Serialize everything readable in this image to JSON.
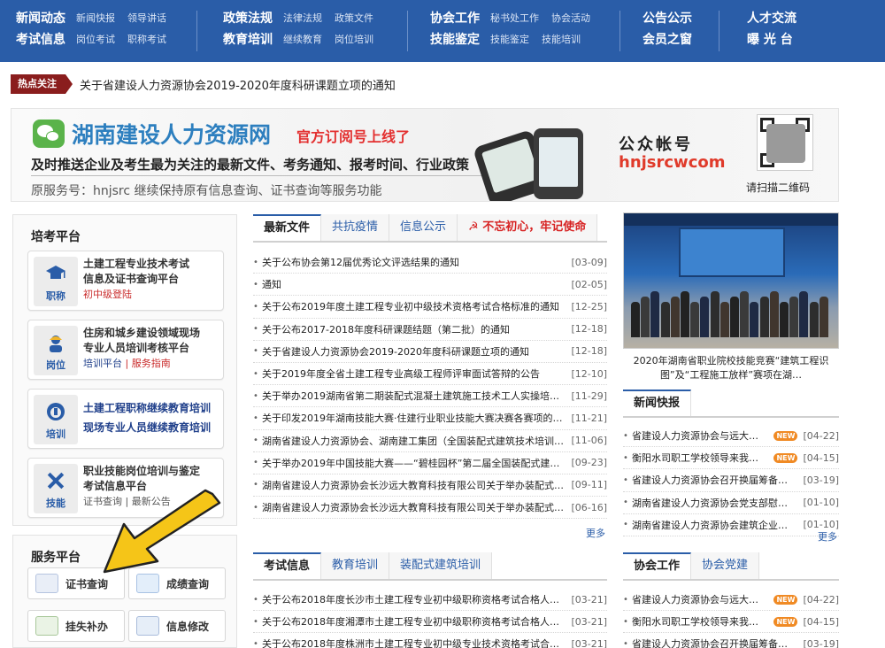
{
  "nav": [
    {
      "main": "新闻动态",
      "subs": [
        "新闻快报",
        "领导讲话"
      ]
    },
    {
      "main": "考试信息",
      "subs": [
        "岗位考试",
        "职称考试"
      ]
    },
    {
      "main": "政策法规",
      "subs": [
        "法律法规",
        "政策文件"
      ]
    },
    {
      "main": "教育培训",
      "subs": [
        "继续教育",
        "岗位培训"
      ]
    },
    {
      "main": "协会工作",
      "subs": [
        "秘书处工作",
        "协会活动"
      ]
    },
    {
      "main": "技能鉴定",
      "subs": [
        "技能鉴定",
        "技能培训"
      ]
    },
    {
      "main": "公告公示",
      "subs": []
    },
    {
      "main": "会员之窗",
      "subs": []
    },
    {
      "main": "人才交流",
      "subs": []
    },
    {
      "main": "曝 光 台",
      "subs": []
    }
  ],
  "hot": {
    "badge": "热点关注",
    "text": "关于省建设人力资源协会2019-2020年度科研课题立项的通知"
  },
  "banner": {
    "title": "湖南建设人力资源网",
    "subtitle": "官方订阅号上线了",
    "line2": "及时推送企业及考生最为关注的最新文件、考务通知、报考时间、行业政策",
    "line3": "原服务号：hnjsrc 继续保持原有信息查询、证书查询等服务功能",
    "account_label": "公众帐号",
    "account_id": "hnjsrcwcom",
    "scan": "请扫描二维码"
  },
  "left": {
    "title": "培考平台",
    "cards": [
      {
        "icon": "职称",
        "lines": [
          "土建工程专业技术考试",
          "信息及证书查询平台"
        ],
        "extra": "初中级登陆"
      },
      {
        "icon": "岗位",
        "lines": [
          "住房和城乡建设领域现场",
          "专业人员培训考核平台"
        ],
        "extra_a": "培训平台",
        "extra_sep": " | ",
        "extra_b": "服务指南"
      },
      {
        "icon": "培训",
        "lines": [
          "土建工程职称继续教育培训",
          "现场专业人员继续教育培训"
        ]
      },
      {
        "icon": "技能",
        "lines": [
          "职业技能岗位培训与鉴定",
          "考试信息平台"
        ],
        "extra": "证书查询 | 最新公告"
      }
    ]
  },
  "service": {
    "title": "服务平台",
    "buttons": [
      "证书查询",
      "成绩查询",
      "挂失补办",
      "信息修改"
    ]
  },
  "middle_top": {
    "tabs": [
      "最新文件",
      "共抗疫情",
      "信息公示",
      "不忘初心，牢记使命"
    ],
    "rows": [
      {
        "t": "关于公布协会第12届优秀论文评选结果的通知",
        "d": "[03-09]"
      },
      {
        "t": "通知",
        "d": "[02-05]"
      },
      {
        "t": "关于公布2019年度土建工程专业初中级技术资格考试合格标准的通知",
        "d": "[12-25]"
      },
      {
        "t": "关于公布2017-2018年度科研课题结题（第二批）的通知",
        "d": "[12-18]"
      },
      {
        "t": "关于省建设人力资源协会2019-2020年度科研课题立项的通知",
        "d": "[12-18]"
      },
      {
        "t": "关于2019年度全省土建工程专业高级工程师评审面试答辩的公告",
        "d": "[12-10]"
      },
      {
        "t": "关于举办2019湖南省第二期装配式混凝土建筑施工技术工人实操培训的通知",
        "d": "[11-29]"
      },
      {
        "t": "关于印发2019年湖南技能大赛·住建行业职业技能大赛决赛各赛项的通知",
        "d": "[11-21]"
      },
      {
        "t": "湖南省建设人力资源协会、湖南建工集团（全国装配式建筑技术培训基地）",
        "d": "[11-06]"
      },
      {
        "t": "关于举办2019年中国技能大赛——“碧桂园杯”第二届全国装配式建筑职业技能竞赛",
        "d": "[09-23]"
      },
      {
        "t": "湖南省建设人力资源协会长沙远大教育科技有限公司关于举办装配式建筑培训",
        "d": "[09-11]"
      },
      {
        "t": "湖南省建设人力资源协会长沙远大教育科技有限公司关于举办装配式建筑施工",
        "d": "[06-16]"
      }
    ],
    "more": "更多"
  },
  "middle_bottom": {
    "tabs": [
      "考试信息",
      "教育培训",
      "装配式建筑培训"
    ],
    "rows": [
      {
        "t": "关于公布2018年度长沙市土建工程专业初中级职称资格考试合格人员名单",
        "d": "[03-21]"
      },
      {
        "t": "关于公布2018年度湘潭市土建工程专业初中级职称资格考试合格人员名单",
        "d": "[03-21]"
      },
      {
        "t": "关于公布2018年度株洲市土建工程专业初中级专业技术资格考试合格人员",
        "d": "[03-21]"
      }
    ]
  },
  "right": {
    "caption": "2020年湖南省职业院校技能竞赛“建筑工程识图”及“工程施工放样”赛项在湖…",
    "news_tabs": [
      "新闻快报"
    ],
    "news": [
      {
        "t": "省建设人力资源协会与远大…",
        "d": "[04-22]",
        "new": true
      },
      {
        "t": "衡阳水司职工学校领导来我…",
        "d": "[04-15]",
        "new": true
      },
      {
        "t": "省建设人力资源协会召开换届筹备…",
        "d": "[03-19]",
        "new": false
      },
      {
        "t": "湖南省建设人力资源协会党支部慰…",
        "d": "[01-10]",
        "new": false
      },
      {
        "t": "湖南省建设人力资源协会建筑企业…",
        "d": "[01-10]",
        "new": false
      }
    ],
    "more": "更多",
    "work_tabs": [
      "协会工作",
      "协会党建"
    ],
    "work": [
      {
        "t": "省建设人力资源协会与远大…",
        "d": "[04-22]",
        "new": true
      },
      {
        "t": "衡阳水司职工学校领导来我…",
        "d": "[04-15]",
        "new": true
      },
      {
        "t": "省建设人力资源协会召开换届筹备…",
        "d": "[03-19]",
        "new": false
      }
    ],
    "new_badge": "NEW"
  },
  "colors": {
    "nav": "#2a5da8",
    "accent_red": "#d72222",
    "hot_badge": "#8a1d1d",
    "new_badge": "#f08a24",
    "arrow": "#f5c518"
  }
}
